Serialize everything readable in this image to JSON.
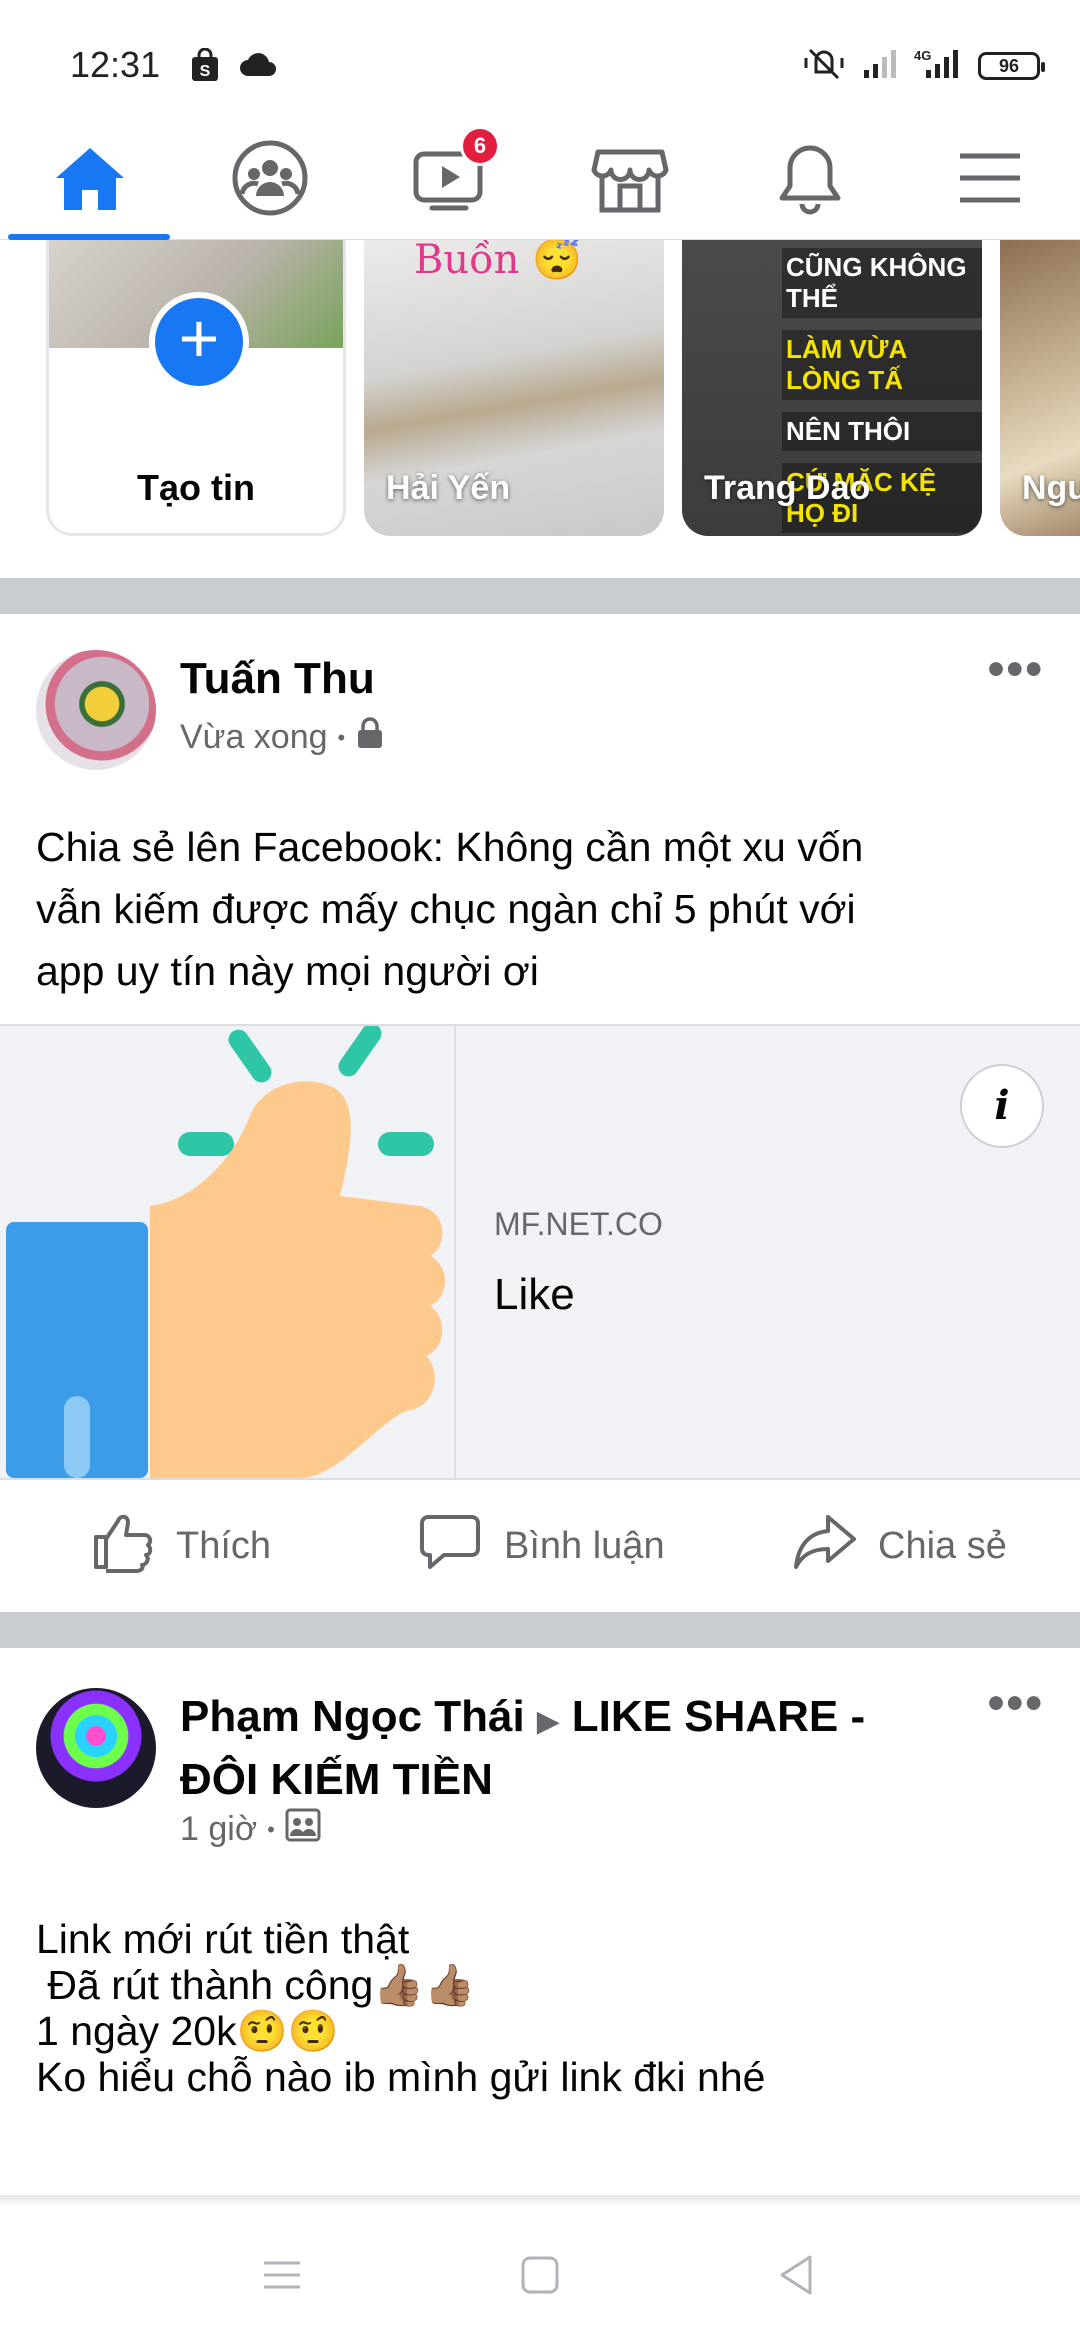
{
  "status_bar": {
    "time": "12:31",
    "battery": "96",
    "left_icons": [
      "shopping-bag-icon",
      "cloud-icon"
    ],
    "right_icons": [
      "mute-vibrate-icon",
      "signal-icon",
      "4g-signal-icon",
      "battery-icon"
    ]
  },
  "nav": {
    "items": [
      "home-icon",
      "groups-icon",
      "watch-icon",
      "marketplace-icon",
      "notifications-icon",
      "menu-icon"
    ],
    "watch_badge": "6",
    "active_color": "#1877f2"
  },
  "stories": {
    "create_label": "Tạo tin",
    "items": [
      {
        "name": "Hải Yến",
        "caption": "Buồn 😴"
      },
      {
        "name": "Trang Dao",
        "lines": [
          "CŨNG KHÔNG THỂ",
          "LÀM VỪA LÒNG TẤ",
          "NÊN THÔI",
          "CỨ MẶC KỆ HỌ ĐI"
        ]
      },
      {
        "name": "Ngu"
      }
    ]
  },
  "post1": {
    "author": "Tuấn Thu",
    "time": "Vừa xong",
    "separator": "•",
    "privacy_icon": "lock-icon",
    "more": "•••",
    "text_lines": [
      "Chia sẻ lên Facebook: Không cần một xu vốn",
      "vẫn kiếm được mấy chục ngàn chỉ 5 phút với",
      "app uy tín này mọi người ơi"
    ],
    "link": {
      "domain": "MF.NET.CO",
      "title": "Like",
      "info": "i"
    },
    "actions": {
      "like": "Thích",
      "comment": "Bình luận",
      "share": "Chia sẻ"
    }
  },
  "post2": {
    "author": "Phạm Ngọc Thái",
    "arrow": "▶",
    "group": "LIKE SHARE -",
    "group_line2": "ĐÔI KIẾM TIỀN",
    "time": "1 giờ",
    "separator": "•",
    "privacy_icon": "group-privacy-icon",
    "more": "•••",
    "text_lines": [
      "Link mới rút tiền thật",
      " Đã rút thành công👍🏽👍🏽",
      "1 ngày 20k🤨🤨",
      "Ko hiểu chỗ nào ib mình gửi link đki nhé"
    ]
  },
  "system_nav": [
    "recents-icon",
    "home-square-icon",
    "back-icon"
  ]
}
